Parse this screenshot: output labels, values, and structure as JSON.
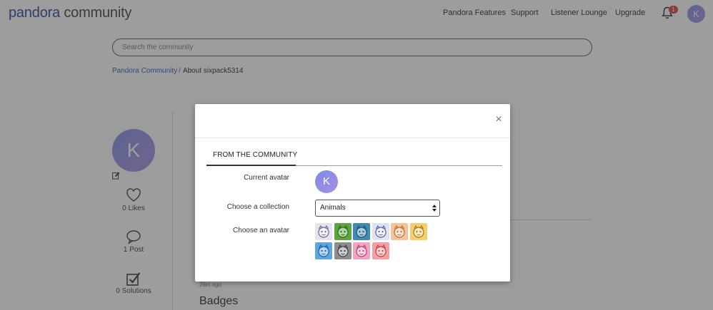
{
  "header": {
    "logo_brand": "pandora",
    "logo_word": " community",
    "nav": [
      "Pandora Features",
      "Support",
      "Listener Lounge",
      "Upgrade"
    ],
    "notification_count": "1",
    "user_initial": "K"
  },
  "search": {
    "placeholder": "Search the community"
  },
  "breadcrumb": {
    "root": "Pandora Community",
    "separator": "/",
    "current": "About sixpack5314"
  },
  "profile": {
    "initial": "K",
    "likes": "0 Likes",
    "posts": "1 Post",
    "solutions": "0 Solutions"
  },
  "content": {
    "time_ago": "26m ago",
    "badges_heading": "Badges"
  },
  "modal": {
    "close_glyph": "×",
    "tab_label": "FROM THE COMMUNITY",
    "current_avatar_label": "Current avatar",
    "current_avatar_initial": "K",
    "collection_label": "Choose a collection",
    "collection_value": "Animals",
    "avatar_label": "Choose an avatar",
    "avatars": [
      {
        "name": "panda",
        "bg": "#e6e2ee",
        "fg": "#6a6498"
      },
      {
        "name": "frog",
        "bg": "#5aa53d",
        "fg": "#2f6a1f"
      },
      {
        "name": "cat",
        "bg": "#3f8bb6",
        "fg": "#1f4f6f"
      },
      {
        "name": "giraffe-sketch",
        "bg": "#dfe2f2",
        "fg": "#5a5f9c"
      },
      {
        "name": "tiger",
        "bg": "#f3c49b",
        "fg": "#c0682c"
      },
      {
        "name": "giraffe",
        "bg": "#f4cd6d",
        "fg": "#a67620"
      },
      {
        "name": "bear",
        "bg": "#5aa7e3",
        "fg": "#2a5e94"
      },
      {
        "name": "gorilla",
        "bg": "#8c8c8c",
        "fg": "#3e3e3e"
      },
      {
        "name": "pig",
        "bg": "#f2a2c3",
        "fg": "#b5427a"
      },
      {
        "name": "rabbit",
        "bg": "#f3a0a3",
        "fg": "#c63b45"
      }
    ]
  }
}
